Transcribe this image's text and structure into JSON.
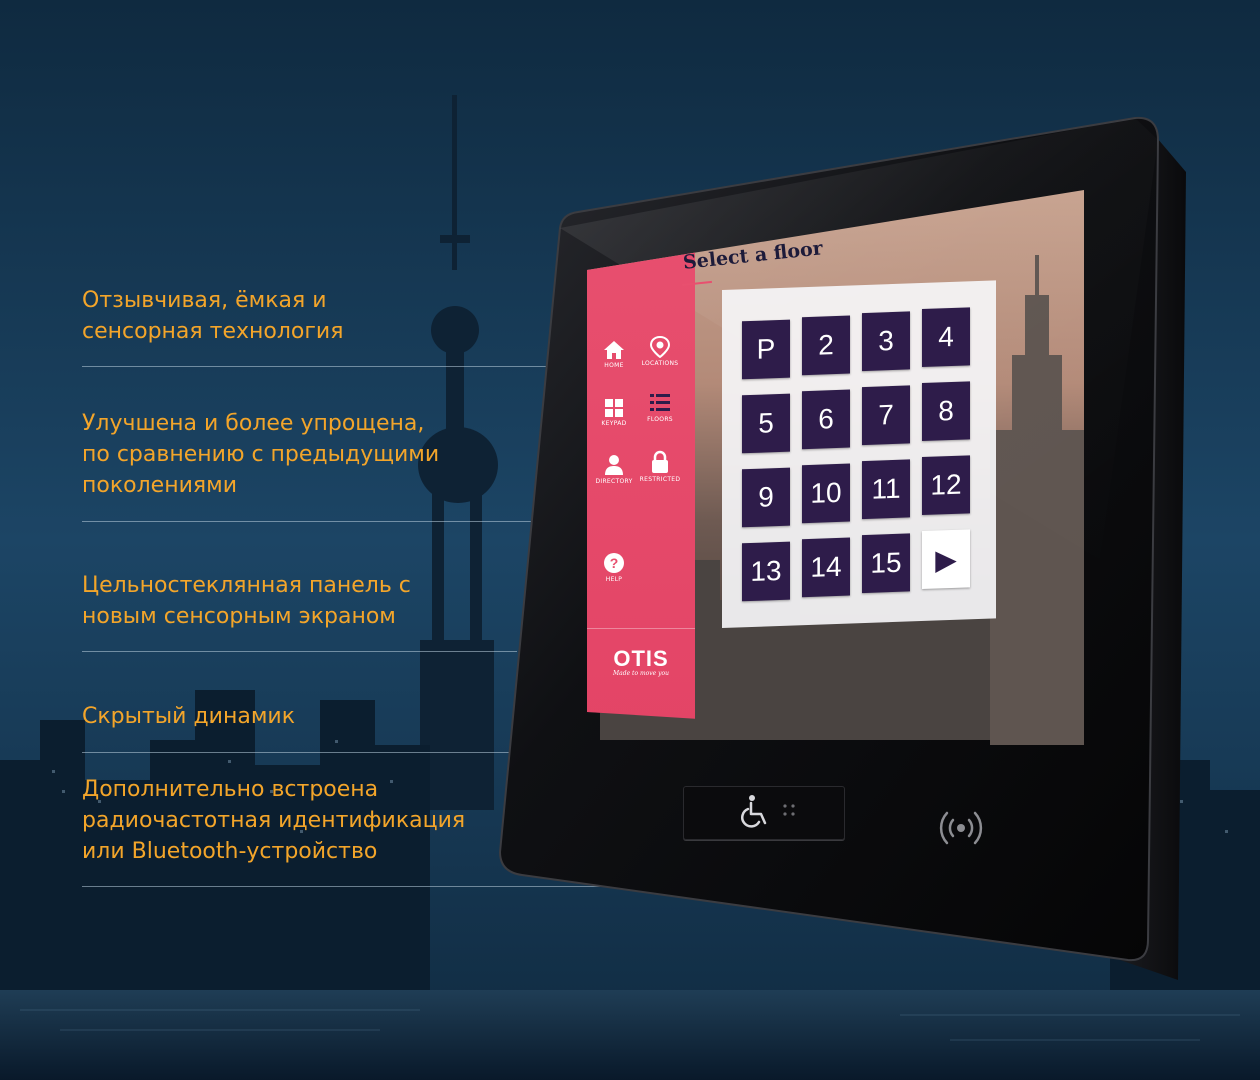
{
  "features": [
    {
      "lines": [
        "Отзывчивая, ёмкая и",
        "сенсорная технология"
      ]
    },
    {
      "lines": [
        "Улучшена и более упрощена,",
        "по сравнению с предыдущими",
        "поколениями"
      ]
    },
    {
      "lines": [
        "Цельностеклянная панель с",
        "новым сенсорным экраном"
      ]
    },
    {
      "lines": [
        "Скрытый динамик"
      ]
    },
    {
      "lines": [
        "Дополнительно встроена",
        "радиочастотная идентификация",
        "или Bluetooth-устройство"
      ]
    }
  ],
  "screen": {
    "title": "Select a floor",
    "nav": [
      {
        "label": "HOME",
        "icon": "home-icon"
      },
      {
        "label": "LOCATIONS",
        "icon": "location-pin-icon"
      },
      {
        "label": "KEYPAD",
        "icon": "keypad-grid-icon"
      },
      {
        "label": "FLOORS",
        "icon": "floor-list-icon"
      },
      {
        "label": "DIRECTORY",
        "icon": "person-icon"
      },
      {
        "label": "RESTRICTED",
        "icon": "lock-icon"
      },
      {
        "label": "HELP",
        "icon": "question-icon"
      }
    ],
    "brand": {
      "name": "OTIS",
      "tagline": "Made to move you"
    },
    "keys": [
      "P",
      "2",
      "3",
      "4",
      "5",
      "6",
      "7",
      "8",
      "9",
      "10",
      "11",
      "12",
      "13",
      "14",
      "15",
      "▶"
    ]
  },
  "hardware": {
    "accessibility_icon": "wheelchair-icon",
    "contactless_icon": "rfid-waves-icon"
  },
  "colors": {
    "accent": "#f3a52a",
    "sidebar": "#e8506f",
    "key": "#2e1c4a",
    "background": "#173a55"
  }
}
